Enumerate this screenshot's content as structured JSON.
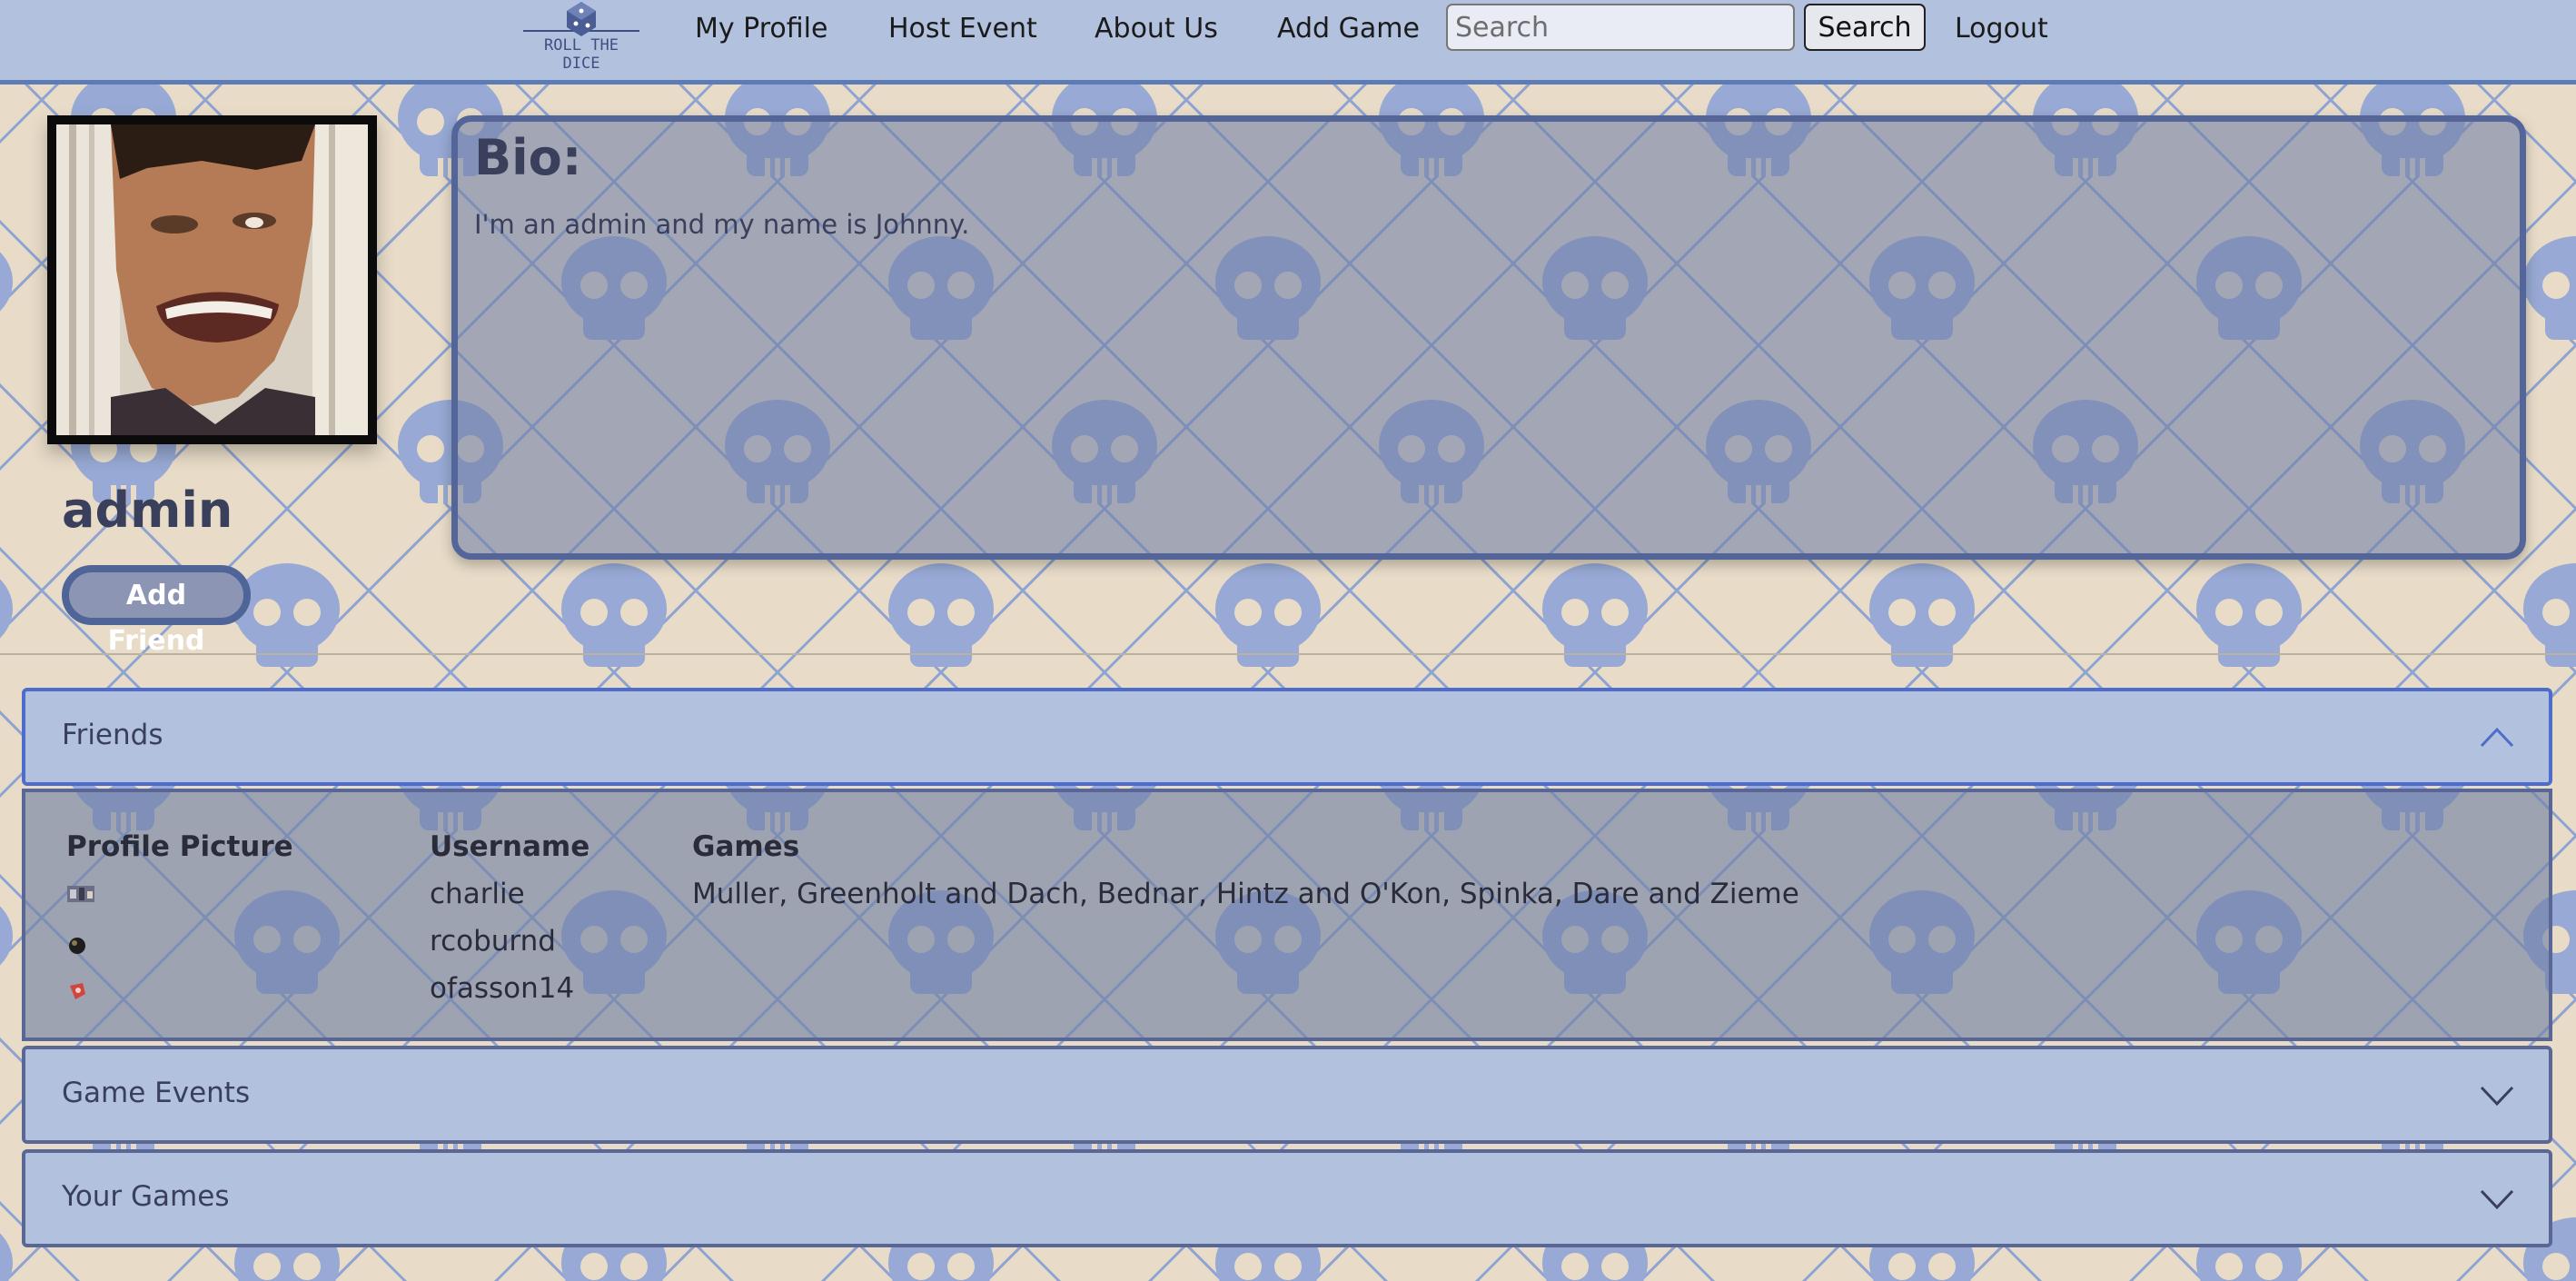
{
  "navbar": {
    "logo_text": "ROLL THE DICE",
    "links": [
      "My Profile",
      "Host Event",
      "About Us",
      "Add Game"
    ],
    "search": {
      "placeholder": "Search",
      "value": "",
      "button_label": "Search"
    },
    "logout_label": "Logout"
  },
  "profile": {
    "username": "admin",
    "add_friend_label": "Add Friend",
    "bio_title": "Bio:",
    "bio_text": "I'm an admin and my name is Johnny."
  },
  "accordion": {
    "friends": {
      "label": "Friends",
      "expanded": true,
      "columns": [
        "Profile Picture",
        "Username",
        "Games"
      ],
      "rows": [
        {
          "picture": "small-thumbnail",
          "username": "charlie",
          "games": "Muller, Greenholt and Dach, Bednar, Hintz and O'Kon, Spinka, Dare and Zieme"
        },
        {
          "picture": "small-thumbnail",
          "username": "rcoburnd",
          "games": ""
        },
        {
          "picture": "small-thumbnail",
          "username": "ofasson14",
          "games": ""
        }
      ]
    },
    "game_events": {
      "label": "Game Events",
      "expanded": false
    },
    "your_games": {
      "label": "Your Games",
      "expanded": false
    }
  },
  "colors": {
    "navbar_bg": "#b2c1de",
    "navbar_border": "#5d7cb5",
    "page_bg": "#e8dcc8",
    "pattern_line": "#8ea3d2",
    "panel_bg": "#8d95b4",
    "panel_border": "#54659a",
    "accent": "#4e6cc9"
  }
}
